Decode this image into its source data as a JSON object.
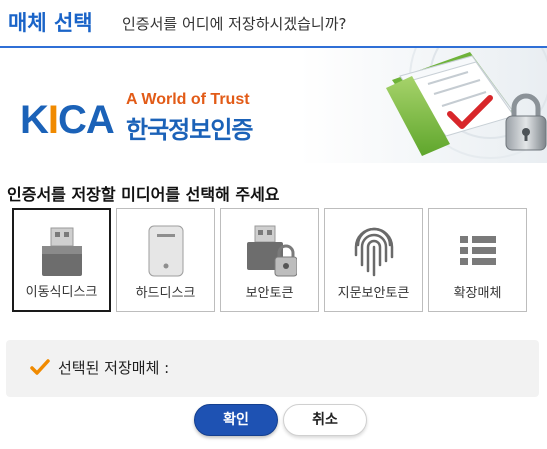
{
  "header": {
    "title": "매체 선택",
    "subtitle": "인증서를 어디에 저장하시겠습니까?"
  },
  "logo": {
    "wordmark_left": "K",
    "wordmark_accent": "I",
    "wordmark_right": "CA",
    "tagline": "A World of Trust",
    "korean_name": "한국정보인증"
  },
  "instruction": "인증서를 저장할 미디어를 선택해 주세요",
  "media": [
    {
      "label": "이동식디스크",
      "icon": "usb-drive-icon",
      "selected": true
    },
    {
      "label": "하드디스크",
      "icon": "hard-disk-icon",
      "selected": false
    },
    {
      "label": "보안토큰",
      "icon": "security-token-icon",
      "selected": false
    },
    {
      "label": "지문보안토큰",
      "icon": "fingerprint-icon",
      "selected": false
    },
    {
      "label": "확장매체",
      "icon": "list-icon",
      "selected": false
    }
  ],
  "selected_panel": {
    "label": "선택된 저장매체 :",
    "value": ""
  },
  "buttons": {
    "ok": "확인",
    "cancel": "취소"
  },
  "colors": {
    "accent": "#1a64c8",
    "check": "#f08a00",
    "ok_button": "#1e52b3"
  }
}
